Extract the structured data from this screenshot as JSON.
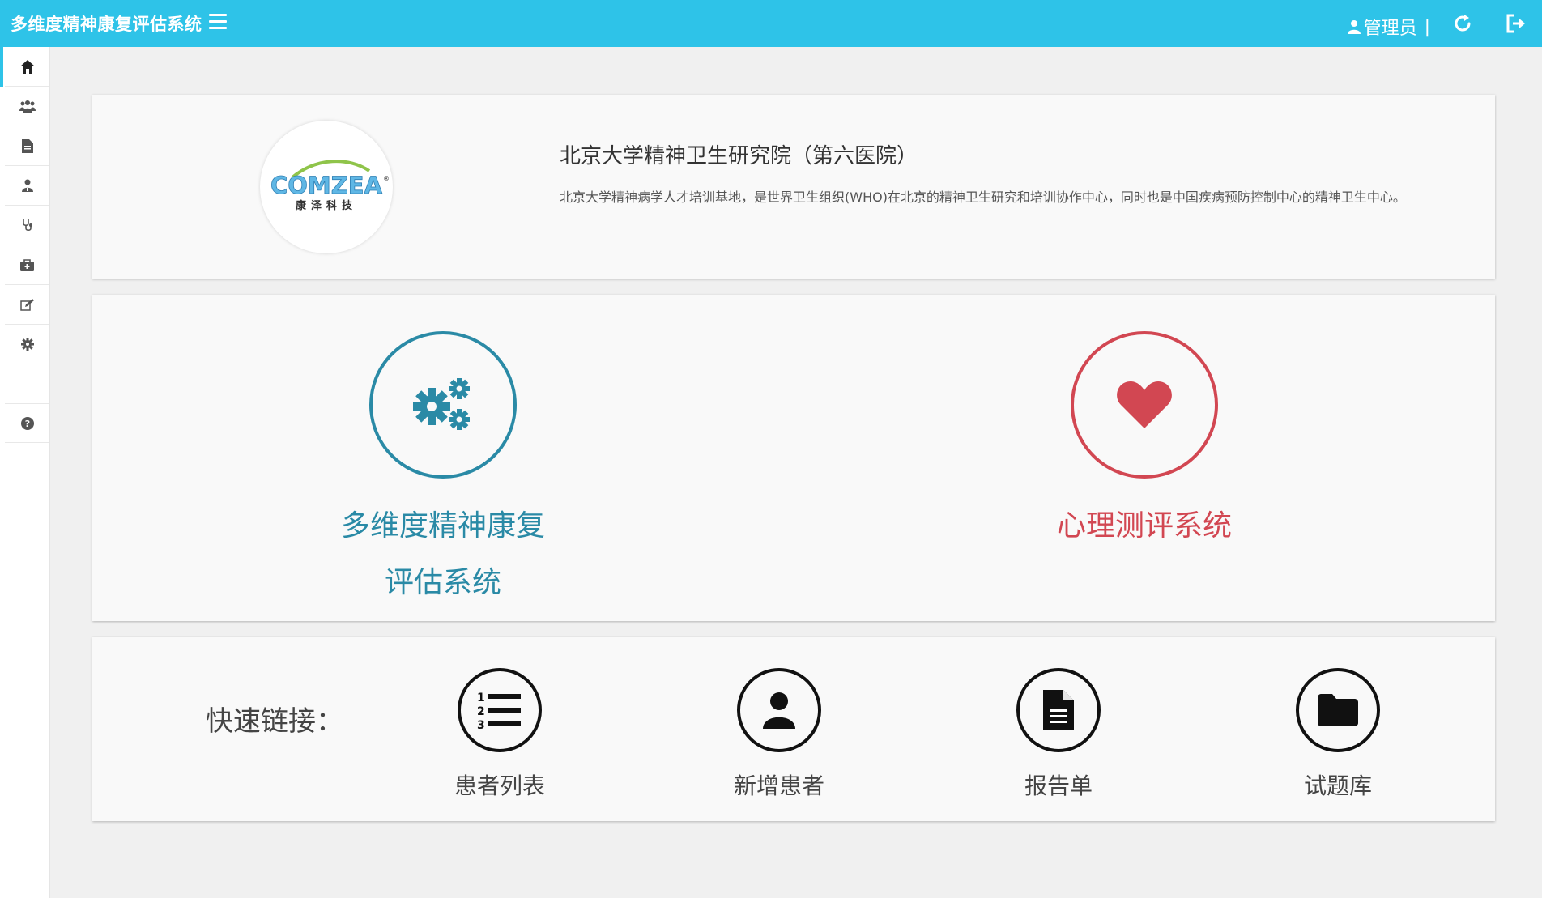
{
  "header": {
    "title": "多维度精神康复评估系统",
    "user_label": "管理员",
    "separator": "|"
  },
  "sidebar": {
    "items": [
      {
        "icon": "home-icon",
        "active": true
      },
      {
        "icon": "users-icon"
      },
      {
        "icon": "document-icon"
      },
      {
        "icon": "user-doctor-icon"
      },
      {
        "icon": "stethoscope-icon"
      },
      {
        "icon": "medkit-icon"
      },
      {
        "icon": "edit-icon"
      },
      {
        "icon": "gear-icon"
      },
      {
        "icon": "help-icon"
      }
    ]
  },
  "hospital": {
    "name": "北京大学精神卫生研究院（第六医院）",
    "description": "北京大学精神病学人才培训基地，是世界卫生组织(WHO)在北京的精神卫生研究和培训协作中心，同时也是中国疾病预防控制中心的精神卫生中心。",
    "logo_text": "COMZEA",
    "logo_subtext": "康泽科技"
  },
  "systems": [
    {
      "line1": "多维度精神康复",
      "line2": "评估系统",
      "icon": "gears-icon",
      "color": "#2a8aa6"
    },
    {
      "line1": "心理测评系统",
      "icon": "heart-icon",
      "color": "#d24752"
    }
  ],
  "quick_links": {
    "label": "快速链接：",
    "items": [
      {
        "label": "患者列表",
        "icon": "numbered-list-icon"
      },
      {
        "label": "新增患者",
        "icon": "user-icon"
      },
      {
        "label": "报告单",
        "icon": "report-icon"
      },
      {
        "label": "试题库",
        "icon": "folder-icon"
      }
    ]
  },
  "colors": {
    "topbar": "#2ec3e8",
    "system1": "#2a8aa6",
    "system2": "#d24752"
  }
}
